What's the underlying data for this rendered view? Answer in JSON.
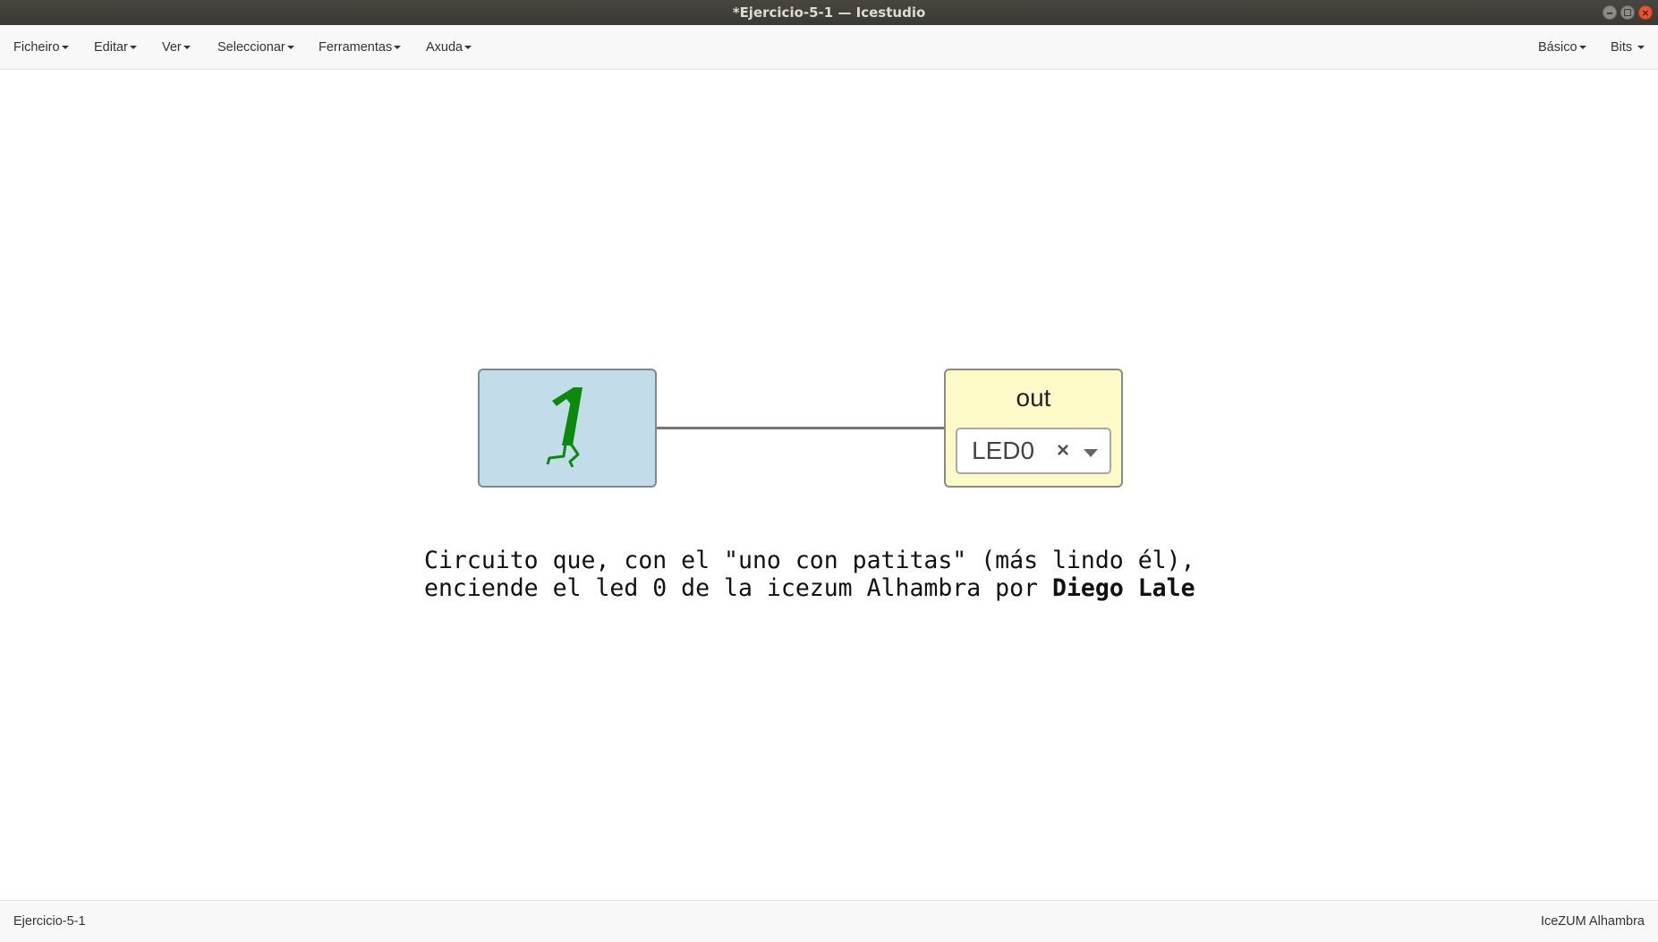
{
  "window": {
    "title": "*Ejercicio-5-1 — Icestudio",
    "controls": [
      "minimize",
      "maximize",
      "close"
    ]
  },
  "menubar": {
    "left": [
      {
        "label": "Ficheiro"
      },
      {
        "label": "Editar"
      },
      {
        "label": "Ver"
      },
      {
        "label": "Seleccionar"
      },
      {
        "label": "Ferramentas"
      },
      {
        "label": "Axuda"
      }
    ],
    "right": [
      {
        "label": "Básico"
      },
      {
        "label": "Bits"
      }
    ]
  },
  "canvas": {
    "constant_block": {
      "icon": "walking-one-icon",
      "fill": "#c2dde9",
      "icon_color": "#0a8a0a"
    },
    "output_block": {
      "label": "out",
      "pin_value": "LED0",
      "clear_glyph": "×",
      "fill": "#fdfac8"
    },
    "comment": {
      "line1": "Circuito que, con el \"uno con patitas\" (más lindo él),",
      "line2_text": "enciende el led 0 de la icezum Alhambra por ",
      "line2_bold": "Diego Lale"
    }
  },
  "statusbar": {
    "project_name": "Ejercicio-5-1",
    "board_name": "IceZUM Alhambra"
  }
}
